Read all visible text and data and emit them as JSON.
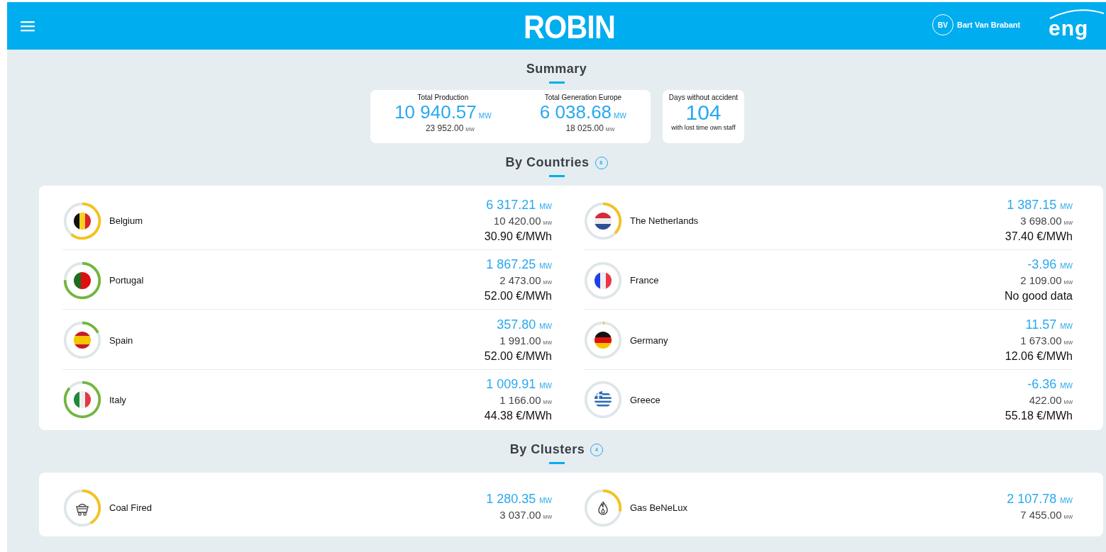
{
  "header": {
    "logo": "ROBIN",
    "user": {
      "initials": "BV",
      "name": "Bart Van Brabant"
    },
    "brand": "eng"
  },
  "summary": {
    "title": "Summary",
    "metrics": [
      {
        "label": "Total Production",
        "value": "10 940.57",
        "unit": "MW",
        "sub_value": "23 952.00",
        "sub_unit": "MW"
      },
      {
        "label": "Total Generation Europe",
        "value": "6 038.68",
        "unit": "MW",
        "sub_value": "18 025.00",
        "sub_unit": "MW"
      }
    ],
    "accident": {
      "label": "Days without accident",
      "value": "104",
      "note": "with lost time own staff"
    }
  },
  "countries": {
    "title": "By Countries",
    "count": "8",
    "items": [
      {
        "name": "Belgium",
        "color": "#f5c21b",
        "value": "6 317.21",
        "unit": "MW",
        "capacity": "10 420.00",
        "capacity_unit": "MW",
        "price": "30.90 €/MWh"
      },
      {
        "name": "The Netherlands",
        "color": "#f5c21b",
        "value": "1 387.15",
        "unit": "MW",
        "capacity": "3 698.00",
        "capacity_unit": "MW",
        "price": "37.40 €/MWh"
      },
      {
        "name": "Portugal",
        "color": "#72b63c",
        "value": "1 867.25",
        "unit": "MW",
        "capacity": "2 473.00",
        "capacity_unit": "MW",
        "price": "52.00 €/MWh"
      },
      {
        "name": "France",
        "value": "-3.96",
        "unit": "MW",
        "capacity": "2 109.00",
        "capacity_unit": "MW",
        "price": "No good data"
      },
      {
        "name": "Spain",
        "color": "#72b63c",
        "value": "357.80",
        "unit": "MW",
        "capacity": "1 991.00",
        "capacity_unit": "MW",
        "price": "52.00 €/MWh"
      },
      {
        "name": "Germany",
        "color": "#f5c21b",
        "value": "11.57",
        "unit": "MW",
        "capacity": "1 673.00",
        "capacity_unit": "MW",
        "price": "12.06 €/MWh"
      },
      {
        "name": "Italy",
        "color": "#72b63c",
        "value": "1 009.91",
        "unit": "MW",
        "capacity": "1 166.00",
        "capacity_unit": "MW",
        "price": "44.38 €/MWh"
      },
      {
        "name": "Greece",
        "value": "-6.36",
        "unit": "MW",
        "capacity": "422.00",
        "capacity_unit": "MW",
        "price": "55.18 €/MWh"
      }
    ]
  },
  "clusters": {
    "title": "By Clusters",
    "count": "4",
    "items": [
      {
        "name": "Coal Fired",
        "color": "#f5c21b",
        "value": "1 280.35",
        "unit": "MW",
        "capacity": "3 037.00",
        "capacity_unit": "MW"
      },
      {
        "name": "Gas BeNeLux",
        "color": "#f5c21b",
        "value": "2 107.78",
        "unit": "MW",
        "capacity": "7 455.00",
        "capacity_unit": "MW"
      }
    ]
  }
}
